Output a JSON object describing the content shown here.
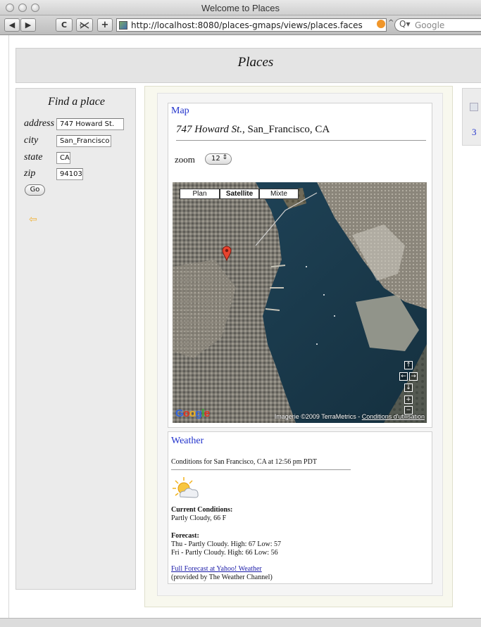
{
  "window": {
    "title": "Welcome to Places"
  },
  "toolbar": {
    "back": "◀",
    "forward": "▶",
    "reload": "C",
    "add": "+",
    "url": "http://localhost:8080/places-gmaps/views/places.faces",
    "search_placeholder": "Google"
  },
  "header": {
    "title": "Places"
  },
  "find": {
    "title": "Find a place",
    "fields": [
      {
        "label": "address",
        "value": "747 Howard St."
      },
      {
        "label": "city",
        "value": "San_Francisco"
      },
      {
        "label": "state",
        "value": "CA"
      },
      {
        "label": "zip",
        "value": "94103"
      }
    ],
    "go_label": "Go"
  },
  "map_section": {
    "heading": "Map",
    "address_street": "747 Howard St.",
    "address_rest": ", San_Francisco, CA",
    "zoom_label": "zoom",
    "zoom_value": "12",
    "map_types": [
      "Plan",
      "Satellite",
      "Mixte"
    ],
    "selected_map_type": "Satellite",
    "nav": {
      "up": "↑",
      "left": "←",
      "right": "→",
      "down": "↓",
      "zoom_in": "+",
      "zoom_out": "−"
    },
    "google_logo": "Google",
    "credit": "Imagerie ©2009 TerraMetrics - ",
    "terms_link": "Conditions d'utilisation"
  },
  "weather": {
    "heading": "Weather",
    "conditions_for": "Conditions for San Francisco, CA at 12:56 pm PDT",
    "current_title": "Current Conditions:",
    "current": "Partly Cloudy, 66 F",
    "forecast_title": "Forecast:",
    "forecast": [
      "Thu - Partly Cloudy. High: 67 Low: 57",
      "Fri - Partly Cloudy. High: 66 Low: 56"
    ],
    "full_link": "Full Forecast at Yahoo! Weather",
    "provided_by": "(provided by The Weather Channel)"
  },
  "right_panel": {
    "number": "3"
  },
  "colors": {
    "link": "#2233cc",
    "header_bg": "#e4e4e4",
    "center_bg": "#f8f8ee",
    "back_icon": "#f0b33a"
  }
}
